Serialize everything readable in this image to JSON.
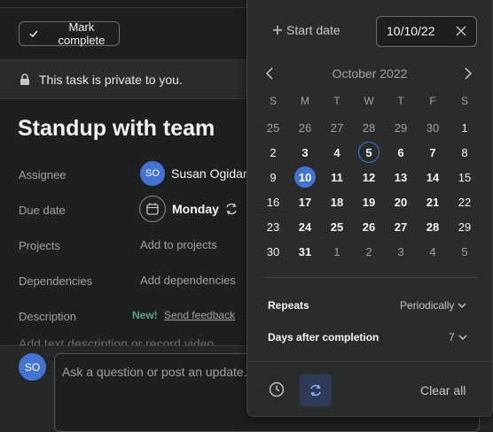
{
  "task": {
    "mark_complete_label": "Mark complete",
    "private_notice": "This task is private to you.",
    "title": "Standup with team",
    "fields": {
      "assignee_label": "Assignee",
      "assignee_initials": "SO",
      "assignee_name": "Susan Ogidan",
      "due_date_label": "Due date",
      "due_date_value": "Monday",
      "projects_label": "Projects",
      "projects_value": "Add to projects",
      "dependencies_label": "Dependencies",
      "dependencies_value": "Add dependencies",
      "description_label": "Description",
      "new_badge": "New!",
      "send_feedback": "Send feedback",
      "description_placeholder": "Add text description or record video"
    },
    "comment": {
      "avatar_initials": "SO",
      "placeholder": "Ask a question or post an update..."
    }
  },
  "date_picker": {
    "start_date_label": "Start date",
    "due_date_input": "10/10/22",
    "month_label": "October 2022",
    "weekdays": [
      "S",
      "M",
      "T",
      "W",
      "T",
      "F",
      "S"
    ],
    "weeks": [
      [
        "25",
        "26",
        "27",
        "28",
        "29",
        "30",
        "1"
      ],
      [
        "2",
        "3",
        "4",
        "5",
        "6",
        "7",
        "8"
      ],
      [
        "9",
        "10",
        "11",
        "12",
        "13",
        "14",
        "15"
      ],
      [
        "16",
        "17",
        "18",
        "19",
        "20",
        "21",
        "22"
      ],
      [
        "23",
        "24",
        "25",
        "26",
        "27",
        "28",
        "29"
      ],
      [
        "30",
        "31",
        "1",
        "2",
        "3",
        "4",
        "5"
      ]
    ],
    "today": "5",
    "selected": "10",
    "repeats_label": "Repeats",
    "repeats_value": "Periodically",
    "days_after_label": "Days after completion",
    "days_after_value": "7",
    "clear_all_label": "Clear all"
  },
  "colors": {
    "accent": "#4573d2",
    "background": "#1e1f21",
    "popover": "#2a2b2d",
    "new_badge": "#5da283"
  }
}
